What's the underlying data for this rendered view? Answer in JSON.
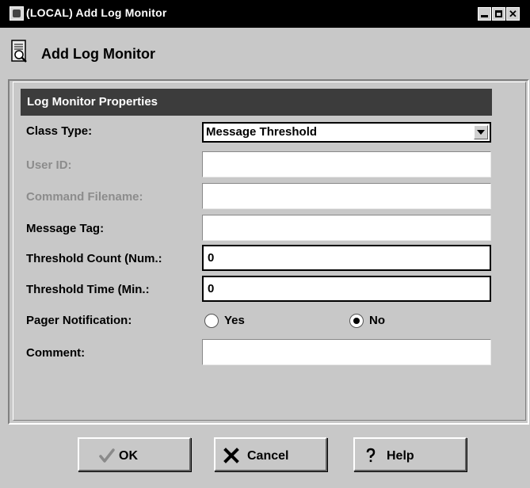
{
  "window": {
    "title": "(LOCAL) Add Log Monitor"
  },
  "header": {
    "title": "Add Log Monitor"
  },
  "section": {
    "title": "Log Monitor Properties"
  },
  "form": {
    "class_type": {
      "label": "Class Type:",
      "value": "Message Threshold"
    },
    "user_id": {
      "label": "User ID:",
      "value": ""
    },
    "command_filename": {
      "label": "Command Filename:",
      "value": ""
    },
    "message_tag": {
      "label": "Message Tag:",
      "value": ""
    },
    "threshold_count": {
      "label": "Threshold Count (Num.:",
      "value": "0"
    },
    "threshold_time": {
      "label": "Threshold Time (Min.:",
      "value": "0"
    },
    "pager_notification": {
      "label": "Pager Notification:",
      "options": [
        "Yes",
        "No"
      ],
      "selected": "No"
    },
    "comment": {
      "label": "Comment:",
      "value": ""
    }
  },
  "buttons": {
    "ok": "OK",
    "cancel": "Cancel",
    "help": "Help"
  },
  "colors": {
    "titlebar": "#000000",
    "section_header": "#3c3c3c",
    "background": "#c8c8c8"
  }
}
